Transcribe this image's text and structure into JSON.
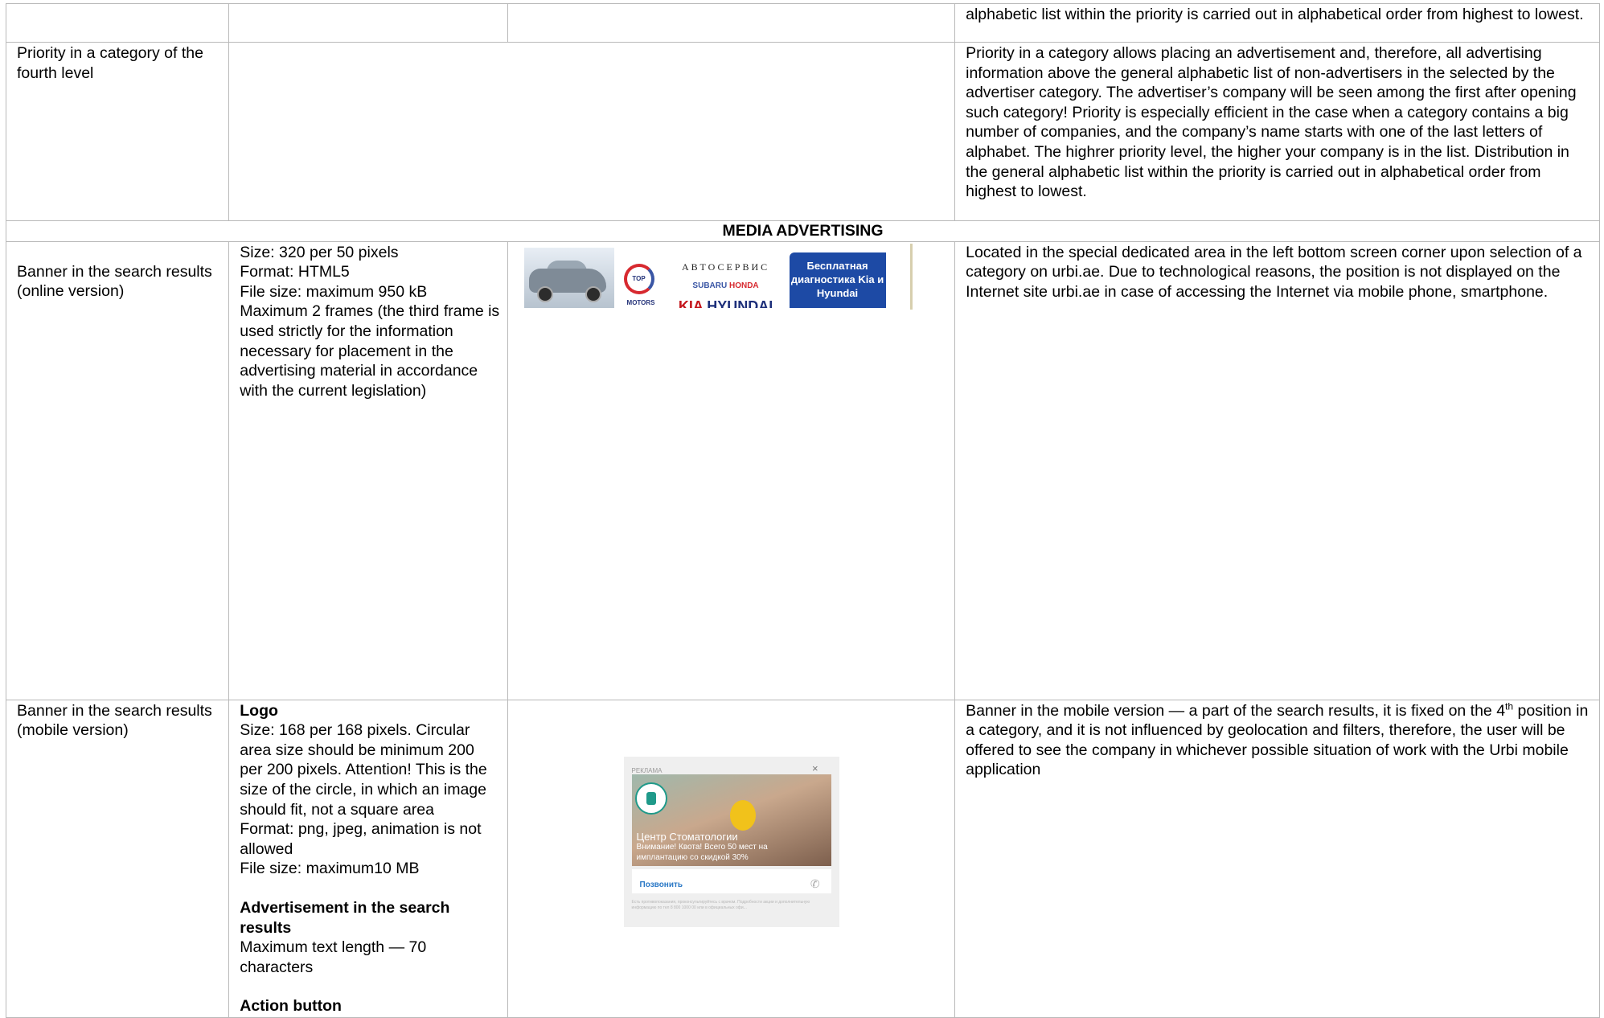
{
  "rows": {
    "row0": {
      "col4": "alphabetic list within the priority is carried out in alphabetical order from highest to lowest."
    },
    "row1": {
      "col1": "Priority in a category of the fourth level",
      "col4": "Priority in a category allows placing an advertisement and, therefore, all advertising information above the general alphabetic list of non-advertisers in the selected by the advertiser category. The advertiser’s company will be seen among the first after opening such category! Priority is especially efficient in the case when a category contains a big number of companies, and the company’s name starts with one of the last letters of alphabet. The highrer priority level, the higher your company is in the list. Distribution in the general alphabetic list within the priority is carried out in alphabetical order from highest to lowest."
    },
    "section": "MEDIA ADVERTISING",
    "row2": {
      "col1": "Banner in the search results (online version)",
      "col2": [
        "Size: 320 per 50 pixels",
        "Format: HTML5",
        "File size: maximum 950 kB",
        "Maximum 2 frames (the third frame is used strictly for the information necessary for placement in the advertising material in accordance with the current legislation)"
      ],
      "banner": {
        "autoservice": "АВТОСЕРВИС",
        "subaru": "SUBARU",
        "honda": "HONDA",
        "kia": "KIA",
        "hyundai": "HYUNDAI",
        "top_motors": "TOP MOTORS",
        "promo": "Бесплатная диагностика Kia и Hyundai"
      },
      "col4": "Located in the special dedicated area in the left bottom screen corner upon selection of a category on urbi.ae. Due to technological reasons, the position is not displayed on the Internet site urbi.ae in case of accessing the Internet via mobile phone, smartphone."
    },
    "row3": {
      "col1": "Banner in the search results (mobile version)",
      "logo_heading": "Logo",
      "logo_text": [
        "Size: 168 per 168 pixels. Circular area size should be minimum 200 per 200 pixels. Attention! This is the size of the circle, in which an image should fit, not a square area",
        "Format: png, jpeg, animation is not allowed",
        "File size: maximum10 MB"
      ],
      "ad_heading": "Advertisement in the search results",
      "ad_text": "Maximum text length — 70 characters",
      "action_heading": "Action button",
      "card": {
        "label": "РЕКЛАМА",
        "close": "×",
        "title": "Центр Стоматологии",
        "subtitle": "Внимание! Квота! Всего 50 мест на имплантацию со скидкой 30%",
        "call": "Позвонить",
        "fine_print": "Есть противопоказания, проконсультируйтесь с врачом. Подробности акции и дополнительную информацию по тел 8 800 1000 00 или в официальных офи..."
      },
      "col4_before": "Banner in the mobile version — a part of the search results, it is fixed on the 4",
      "col4_sup": "th",
      "col4_after": " position in a category, and it is not influenced by geolocation and filters, therefore, the user will be offered to see the company in whichever possible situation of work with the Urbi mobile application"
    }
  }
}
